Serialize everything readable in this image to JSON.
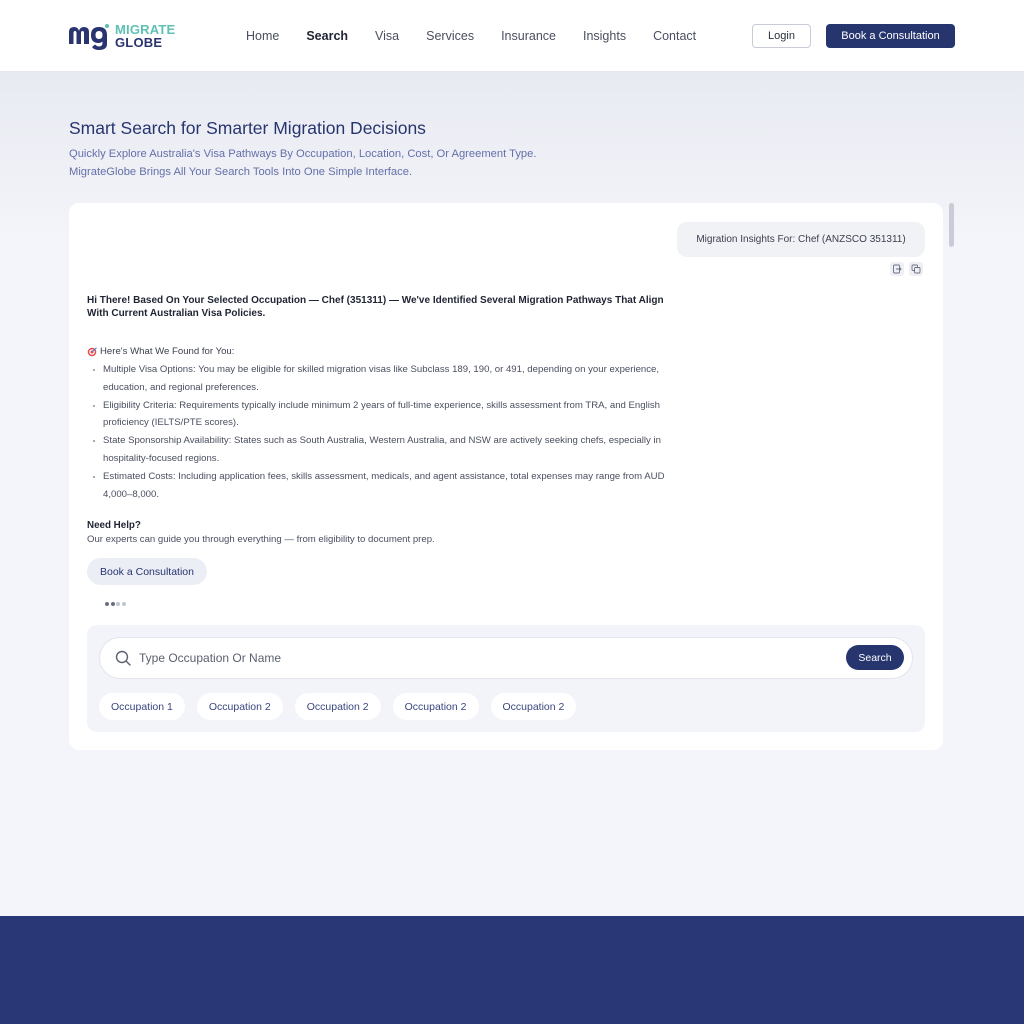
{
  "header": {
    "logo_top": "MIGRATE",
    "logo_bottom": "GLOBE",
    "nav": [
      {
        "label": "Home",
        "active": false
      },
      {
        "label": "Search",
        "active": true
      },
      {
        "label": "Visa",
        "active": false
      },
      {
        "label": "Services",
        "active": false
      },
      {
        "label": "Insurance",
        "active": false
      },
      {
        "label": "Insights",
        "active": false
      },
      {
        "label": "Contact",
        "active": false
      }
    ],
    "login_label": "Login",
    "book_label": "Book a Consultation"
  },
  "hero": {
    "title": "Smart Search for Smarter Migration Decisions",
    "subtitle_line1": "Quickly Explore Australia's Visa Pathways By Occupation, Location, Cost, Or Agreement Type.",
    "subtitle_line2": "MigrateGlobe Brings All Your Search Tools Into One Simple Interface."
  },
  "chat": {
    "user_message": "Migration Insights For: Chef (ANZSCO 351311)",
    "reply_intro": "Hi There! Based On Your Selected Occupation — Chef (351311) — We've Identified Several Migration Pathways That Align With Current Australian Visa Policies.",
    "found_heading": "Here's What We Found for You:",
    "bullets": [
      "Multiple Visa Options: You may be eligible for skilled migration visas like Subclass 189, 190, or 491, depending on your experience, education, and regional preferences.",
      "Eligibility Criteria: Requirements typically include minimum 2 years of full-time experience, skills assessment from TRA, and English proficiency (IELTS/PTE scores).",
      "State Sponsorship Availability: States such as South Australia, Western Australia, and NSW are actively seeking chefs, especially in hospitality-focused regions.",
      "Estimated Costs: Including application fees, skills assessment, medicals, and agent assistance, total expenses may range from AUD 4,000–8,000."
    ],
    "help_title": "Need Help?",
    "help_text": "Our experts can guide you through everything — from eligibility to document prep.",
    "book_label": "Book a Consultation"
  },
  "search": {
    "placeholder": "Type Occupation Or Name",
    "button_label": "Search",
    "chips": [
      "Occupation 1",
      "Occupation 2",
      "Occupation 2",
      "Occupation 2",
      "Occupation 2"
    ]
  },
  "icons": {
    "copy": "copy-icon",
    "export": "export-icon",
    "search": "search-icon",
    "target": "target-icon"
  },
  "colors": {
    "brand_navy": "#27356f",
    "brand_teal": "#5fc0b4",
    "footer": "#293777"
  }
}
